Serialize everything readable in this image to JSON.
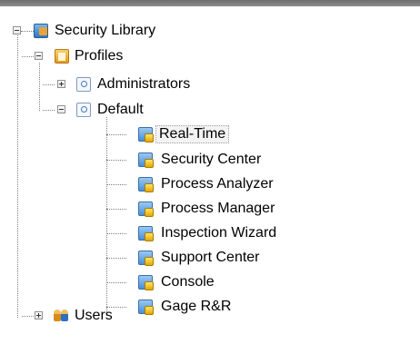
{
  "tree": {
    "root": {
      "label": "Security Library",
      "expanded": true,
      "icon": "security-library-icon",
      "children": {
        "profiles": {
          "label": "Profiles",
          "expanded": true,
          "icon": "profiles-folder-icon",
          "children": {
            "administrators": {
              "label": "Administrators",
              "expanded": false,
              "icon": "profile-icon"
            },
            "default": {
              "label": "Default",
              "expanded": true,
              "icon": "profile-icon",
              "items": [
                {
                  "label": "Real-Time",
                  "selected": true,
                  "icon": "permission-lock-icon"
                },
                {
                  "label": "Security Center",
                  "icon": "permission-lock-icon"
                },
                {
                  "label": "Process Analyzer",
                  "icon": "permission-lock-icon"
                },
                {
                  "label": "Process Manager",
                  "icon": "permission-lock-icon"
                },
                {
                  "label": "Inspection Wizard",
                  "icon": "permission-lock-icon"
                },
                {
                  "label": "Support Center",
                  "icon": "permission-lock-icon"
                },
                {
                  "label": "Console",
                  "icon": "permission-lock-icon"
                },
                {
                  "label": "Gage R&R",
                  "icon": "permission-lock-icon"
                }
              ]
            }
          }
        },
        "users": {
          "label": "Users",
          "expanded": false,
          "icon": "users-icon"
        }
      }
    }
  }
}
